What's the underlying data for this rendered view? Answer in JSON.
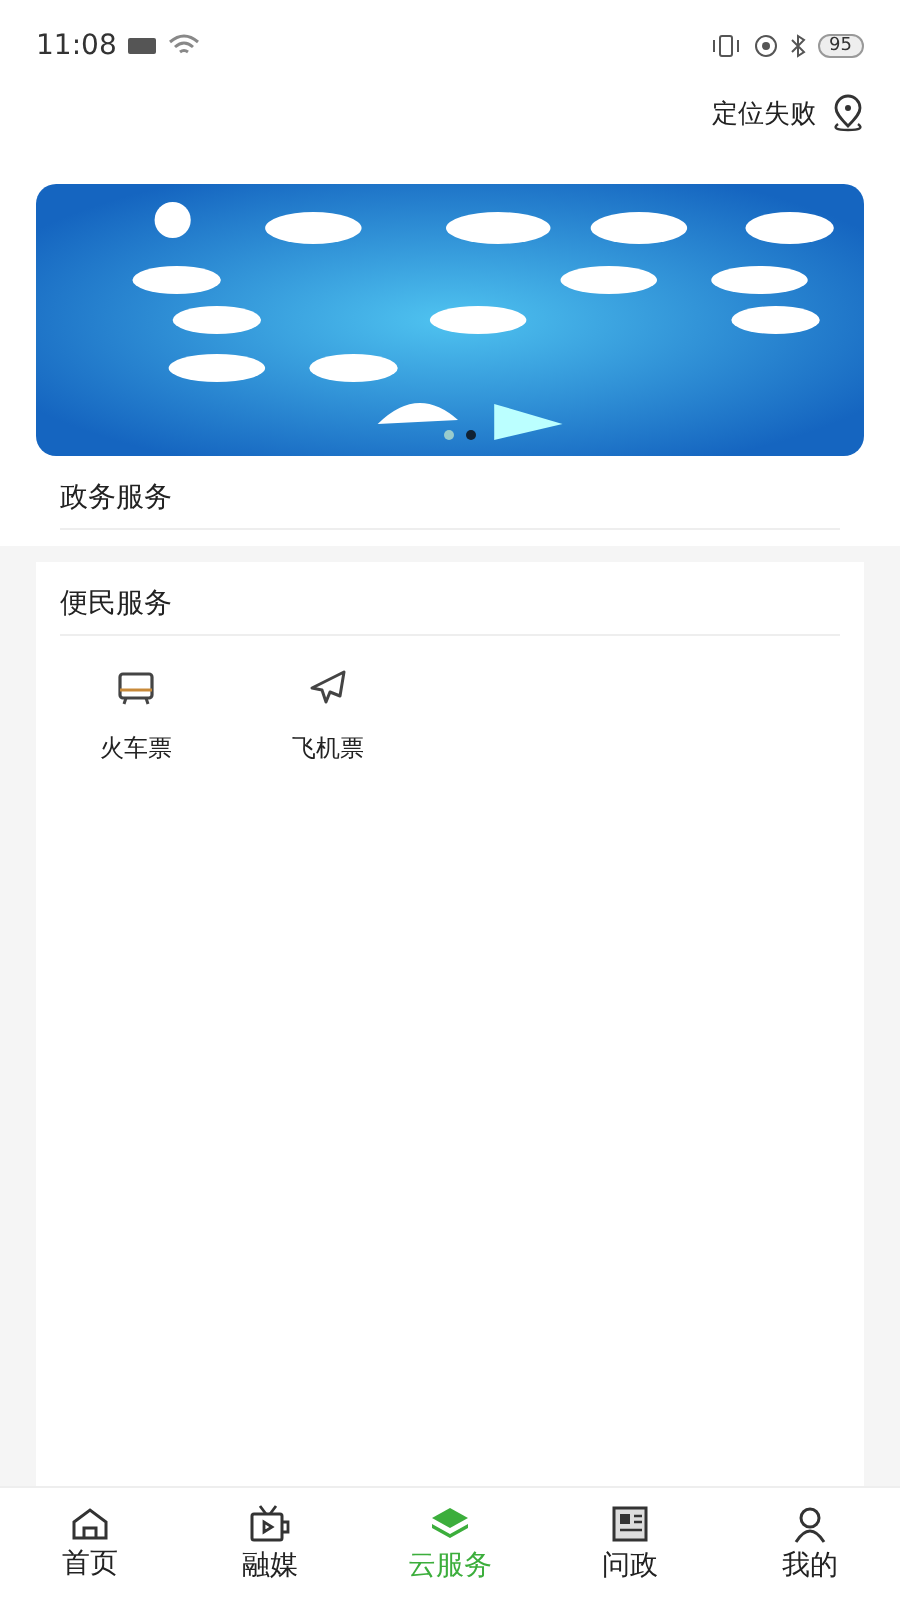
{
  "status_bar": {
    "time": "11:08",
    "battery": "95"
  },
  "location": {
    "label": "定位失败"
  },
  "banner": {
    "dots": [
      {
        "selected": false
      },
      {
        "selected": true
      }
    ]
  },
  "sections": [
    {
      "title": "政务服务"
    },
    {
      "title": "便民服务",
      "items": [
        {
          "label": "火车票",
          "kind": "train"
        },
        {
          "label": "飞机票",
          "kind": "plane"
        }
      ]
    }
  ],
  "tabs": [
    {
      "label": "首页",
      "kind": "home",
      "selected": false
    },
    {
      "label": "融媒",
      "kind": "tv",
      "selected": false
    },
    {
      "label": "云服务",
      "kind": "cloud",
      "selected": true
    },
    {
      "label": "问政",
      "kind": "news",
      "selected": false
    },
    {
      "label": "我的",
      "kind": "user",
      "selected": false
    }
  ]
}
